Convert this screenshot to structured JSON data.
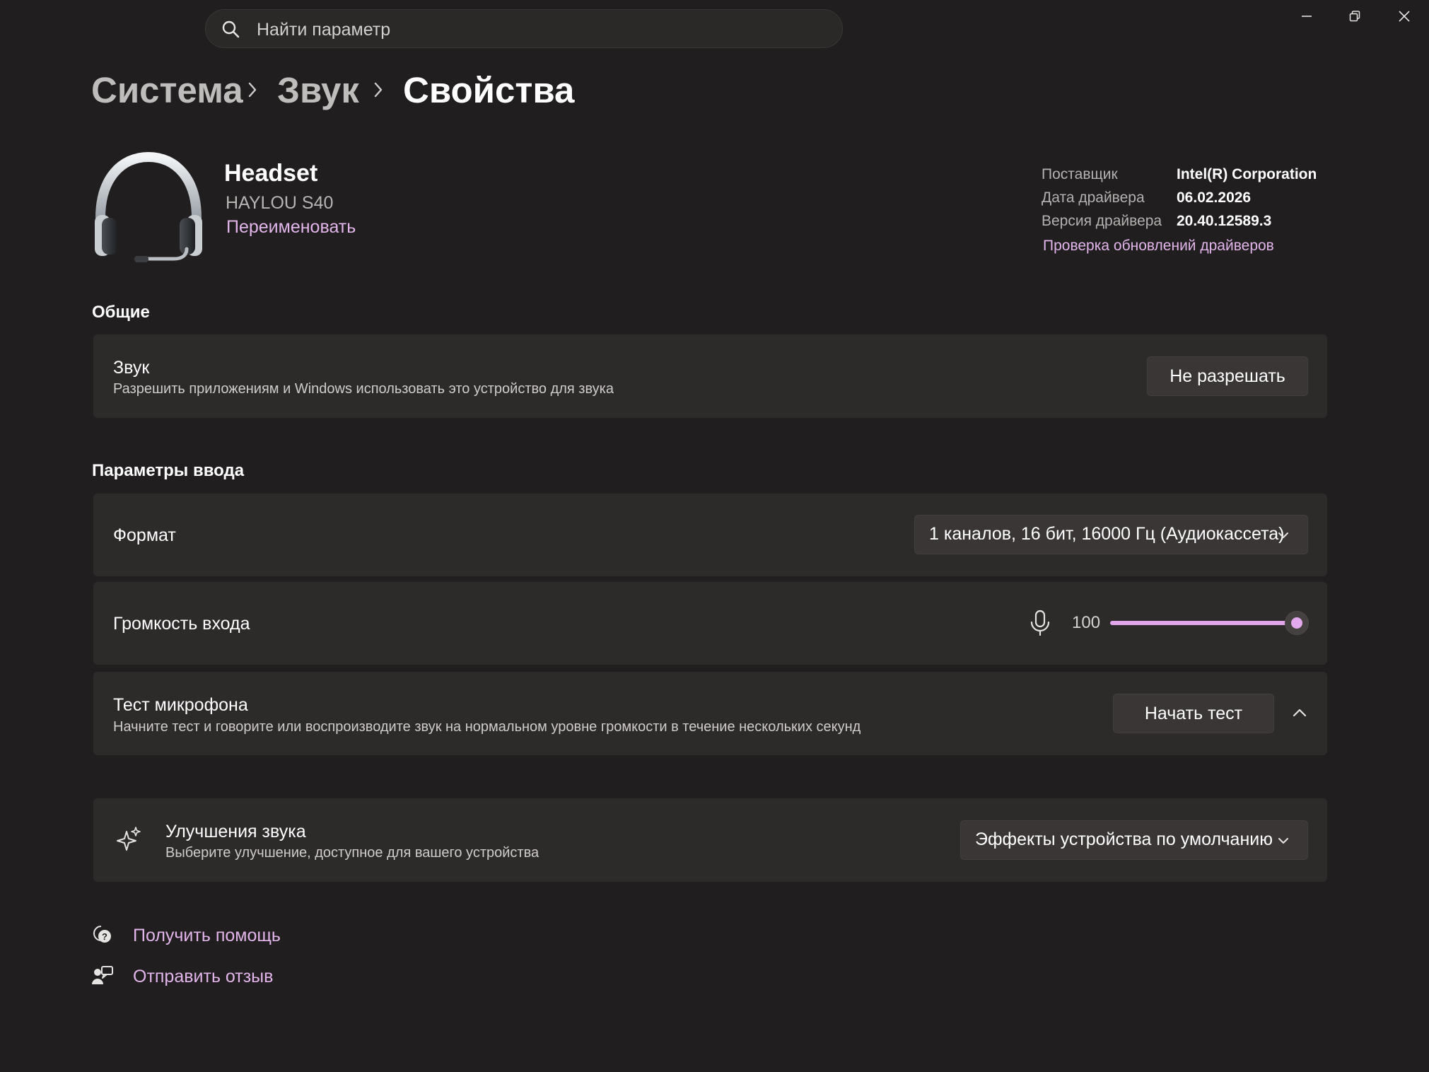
{
  "search": {
    "placeholder": "Найти параметр"
  },
  "breadcrumb": {
    "items": [
      "Система",
      "Звук",
      "Свойства"
    ]
  },
  "device": {
    "name": "Headset",
    "model": "HAYLOU S40",
    "rename_label": "Переименовать",
    "info": {
      "vendor_label": "Поставщик",
      "vendor_value": "Intel(R) Corporation",
      "date_label": "Дата драйвера",
      "date_value": "06.02.2026",
      "version_label": "Версия драйвера",
      "version_value": "20.40.12589.3",
      "update_link": "Проверка обновлений драйверов"
    }
  },
  "general": {
    "heading": "Общие",
    "audio": {
      "title": "Звук",
      "subtitle": "Разрешить приложениям и Windows использовать это устройство для звука",
      "button": "Не разрешать"
    }
  },
  "input": {
    "heading": "Параметры ввода",
    "format": {
      "title": "Формат",
      "value": "1 каналов, 16 бит, 16000 Гц (Аудиокассета)"
    },
    "volume": {
      "title": "Громкость входа",
      "value": "100",
      "level": 100
    },
    "mic_test": {
      "title": "Тест микрофона",
      "subtitle": "Начните тест и говорите или воспроизводите звук на нормальном уровне громкости в течение нескольких секунд",
      "button": "Начать тест"
    }
  },
  "enhancements": {
    "title": "Улучшения звука",
    "subtitle": "Выберите улучшение, доступное для вашего устройства",
    "value": "Эффекты устройства по умолчанию"
  },
  "footer": {
    "help": "Получить помощь",
    "feedback": "Отправить отзыв"
  },
  "colors": {
    "background": "#201e1e",
    "card": "#2d2a2a",
    "accent": "#e3b5ec"
  },
  "icons": [
    "search-icon",
    "minimize-icon",
    "restore-icon",
    "close-icon",
    "chevron-right-icon",
    "headset-icon",
    "chevron-down-icon",
    "microphone-icon",
    "chevron-up-icon",
    "sparkle-icon",
    "help-icon",
    "feedback-icon"
  ]
}
